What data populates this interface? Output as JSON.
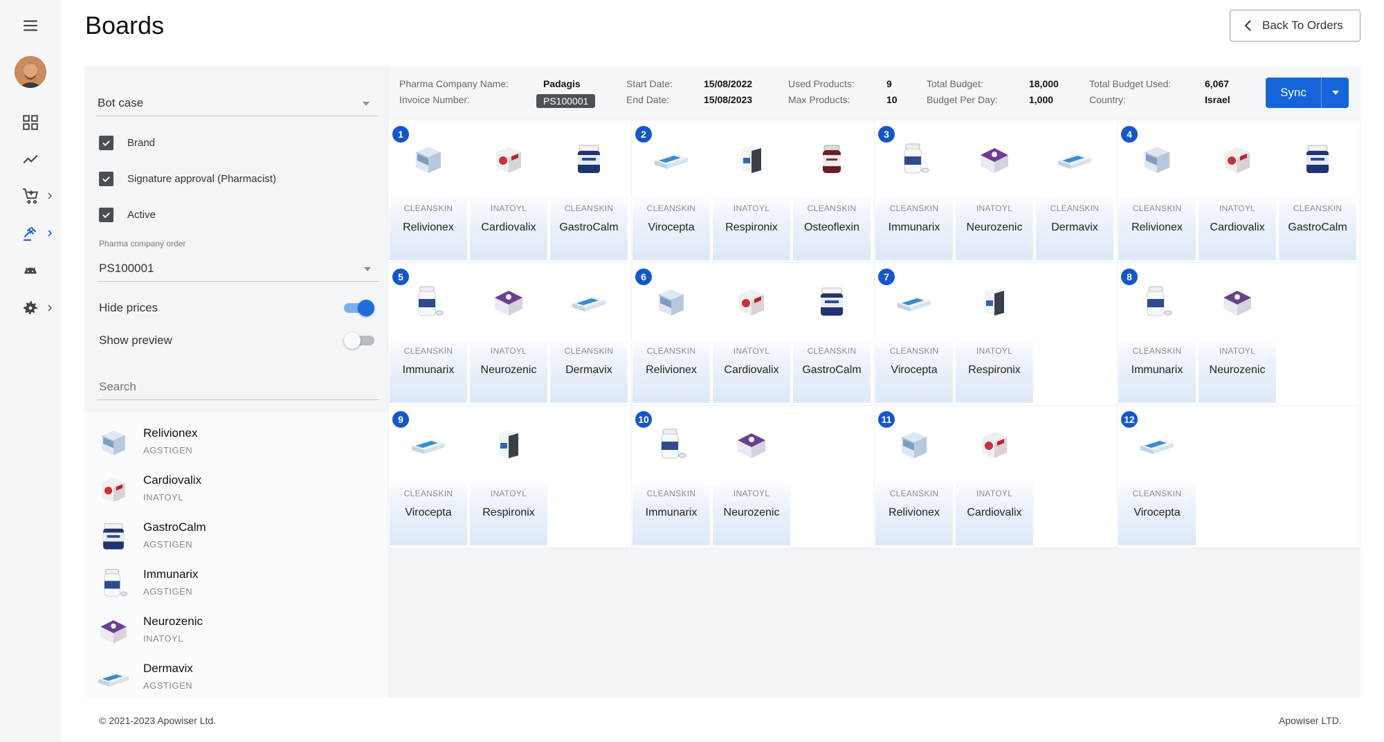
{
  "app": {
    "title": "Boards"
  },
  "header": {
    "back_label": "Back To Orders"
  },
  "filters": {
    "bot_case_value": "Bot case",
    "checkboxes": [
      {
        "label": "Brand",
        "checked": true
      },
      {
        "label": "Signature approval (Pharmacist)",
        "checked": true
      },
      {
        "label": "Active",
        "checked": true
      }
    ],
    "pharma_order_label": "Pharma company order",
    "pharma_order_value": "PS100001",
    "hide_prices_label": "Hide prices",
    "hide_prices_on": true,
    "show_preview_label": "Show preview",
    "show_preview_on": false,
    "search_placeholder": "Search"
  },
  "products": [
    {
      "name": "Relivionex",
      "brand": "AGSTIGEN",
      "icon": "box-blue"
    },
    {
      "name": "Cardiovalix",
      "brand": "INATOYL",
      "icon": "box-red"
    },
    {
      "name": "GastroCalm",
      "brand": "AGSTIGEN",
      "icon": "jar-navy"
    },
    {
      "name": "Immunarix",
      "brand": "AGSTIGEN",
      "icon": "bottle-white"
    },
    {
      "name": "Neurozenic",
      "brand": "INATOYL",
      "icon": "box-purple"
    },
    {
      "name": "Dermavix",
      "brand": "AGSTIGEN",
      "icon": "pack-flat"
    }
  ],
  "info": {
    "company_label": "Pharma Company Name:",
    "company_value": "Padagis",
    "invoice_label": "Invoice Number:",
    "invoice_value": "PS100001",
    "start_label": "Start Date:",
    "start_value": "15/08/2022",
    "end_label": "End Date:",
    "end_value": "15/08/2023",
    "used_label": "Used Products:",
    "used_value": "9",
    "max_label": "Max Products:",
    "max_value": "10",
    "budget_label": "Total Budget:",
    "budget_value": "18,000",
    "perday_label": "Budget Per Day:",
    "perday_value": "1,000",
    "budget_used_label": "Total Budget Used:",
    "budget_used_value": "6,067",
    "country_label": "Country:",
    "country_value": "Israel"
  },
  "sync_label": "Sync",
  "boards": [
    {
      "num": "1",
      "tiles": [
        {
          "brand": "CLEANSKIN",
          "name": "Relivionex",
          "icon": "box-blue"
        },
        {
          "brand": "INATOYL",
          "name": "Cardiovalix",
          "icon": "box-red"
        },
        {
          "brand": "CLEANSKIN",
          "name": "GastroCalm",
          "icon": "jar-navy"
        }
      ]
    },
    {
      "num": "2",
      "tiles": [
        {
          "brand": "CLEANSKIN",
          "name": "Virocepta",
          "icon": "pack-flat"
        },
        {
          "brand": "INATOYL",
          "name": "Respironix",
          "icon": "box-tall"
        },
        {
          "brand": "CLEANSKIN",
          "name": "Osteoflexin",
          "icon": "jar-dark"
        }
      ]
    },
    {
      "num": "3",
      "tiles": [
        {
          "brand": "CLEANSKIN",
          "name": "Immunarix",
          "icon": "bottle-white"
        },
        {
          "brand": "INATOYL",
          "name": "Neurozenic",
          "icon": "box-purple"
        },
        {
          "brand": "CLEANSKIN",
          "name": "Dermavix",
          "icon": "pack-flat"
        }
      ]
    },
    {
      "num": "4",
      "tiles": [
        {
          "brand": "CLEANSKIN",
          "name": "Relivionex",
          "icon": "box-blue"
        },
        {
          "brand": "INATOYL",
          "name": "Cardiovalix",
          "icon": "box-red"
        },
        {
          "brand": "CLEANSKIN",
          "name": "GastroCalm",
          "icon": "jar-navy"
        }
      ]
    },
    {
      "num": "5",
      "tiles": [
        {
          "brand": "CLEANSKIN",
          "name": "Immunarix",
          "icon": "bottle-white"
        },
        {
          "brand": "INATOYL",
          "name": "Neurozenic",
          "icon": "box-purple"
        },
        {
          "brand": "CLEANSKIN",
          "name": "Dermavix",
          "icon": "pack-flat"
        }
      ]
    },
    {
      "num": "6",
      "tiles": [
        {
          "brand": "CLEANSKIN",
          "name": "Relivionex",
          "icon": "box-blue"
        },
        {
          "brand": "INATOYL",
          "name": "Cardiovalix",
          "icon": "box-red"
        },
        {
          "brand": "CLEANSKIN",
          "name": "GastroCalm",
          "icon": "jar-navy"
        }
      ]
    },
    {
      "num": "7",
      "tiles": [
        {
          "brand": "CLEANSKIN",
          "name": "Virocepta",
          "icon": "pack-flat"
        },
        {
          "brand": "INATOYL",
          "name": "Respironix",
          "icon": "box-tall"
        }
      ]
    },
    {
      "num": "8",
      "tiles": [
        {
          "brand": "CLEANSKIN",
          "name": "Immunarix",
          "icon": "bottle-white"
        },
        {
          "brand": "INATOYL",
          "name": "Neurozenic",
          "icon": "box-purple"
        }
      ]
    },
    {
      "num": "9",
      "tiles": [
        {
          "brand": "CLEANSKIN",
          "name": "Virocepta",
          "icon": "pack-flat"
        },
        {
          "brand": "INATOYL",
          "name": "Respironix",
          "icon": "box-tall"
        }
      ]
    },
    {
      "num": "10",
      "tiles": [
        {
          "brand": "CLEANSKIN",
          "name": "Immunarix",
          "icon": "bottle-white"
        },
        {
          "brand": "INATOYL",
          "name": "Neurozenic",
          "icon": "box-purple"
        }
      ]
    },
    {
      "num": "11",
      "tiles": [
        {
          "brand": "CLEANSKIN",
          "name": "Relivionex",
          "icon": "box-blue"
        },
        {
          "brand": "INATOYL",
          "name": "Cardiovalix",
          "icon": "box-red"
        }
      ]
    },
    {
      "num": "12",
      "tiles": [
        {
          "brand": "CLEANSKIN",
          "name": "Virocepta",
          "icon": "pack-flat"
        }
      ]
    }
  ],
  "footer": {
    "copyright": "© 2021-2023 Apowiser Ltd.",
    "company": "Apowiser LTD."
  },
  "colors": {
    "accent": "#1565d8",
    "badge": "#1556c9"
  }
}
